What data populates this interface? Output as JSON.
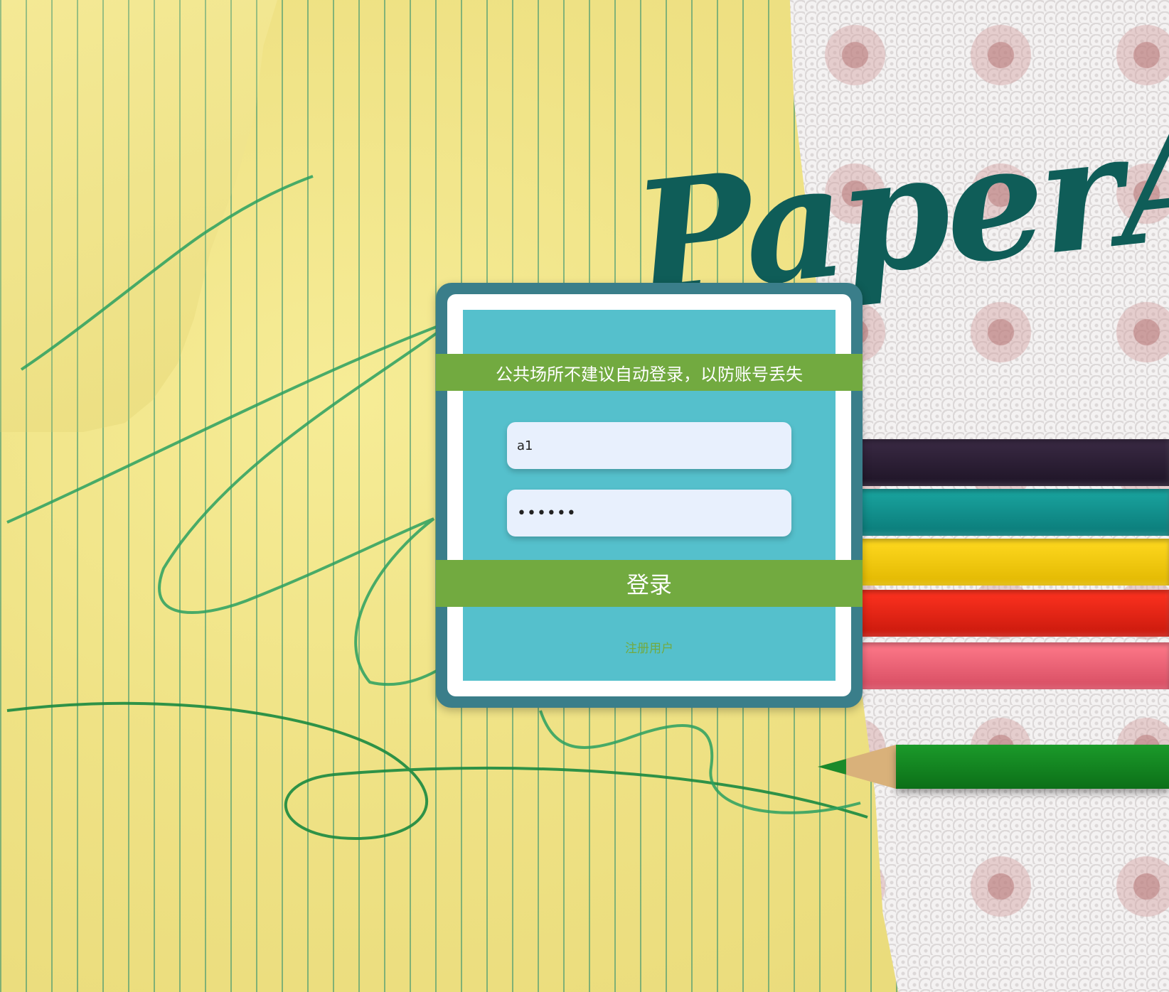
{
  "brand": {
    "text": "PaperAr"
  },
  "login": {
    "notice": "公共场所不建议自动登录，以防账号丢失",
    "username_value": "a1",
    "password_value": "••••••",
    "submit_label": "登录",
    "register_label": "注册用户"
  },
  "colors": {
    "panel_frame": "#3a7e8a",
    "panel_body": "#55c0cc",
    "band_green": "#72aa40",
    "field_bg": "#e8f0fd",
    "brand_teal": "#0f5d58"
  },
  "decor": {
    "pencils": [
      "dark-purple-pencil",
      "teal-pencil",
      "yellow-pencil",
      "red-pencil",
      "pink-pencil",
      "green-pencil"
    ]
  }
}
